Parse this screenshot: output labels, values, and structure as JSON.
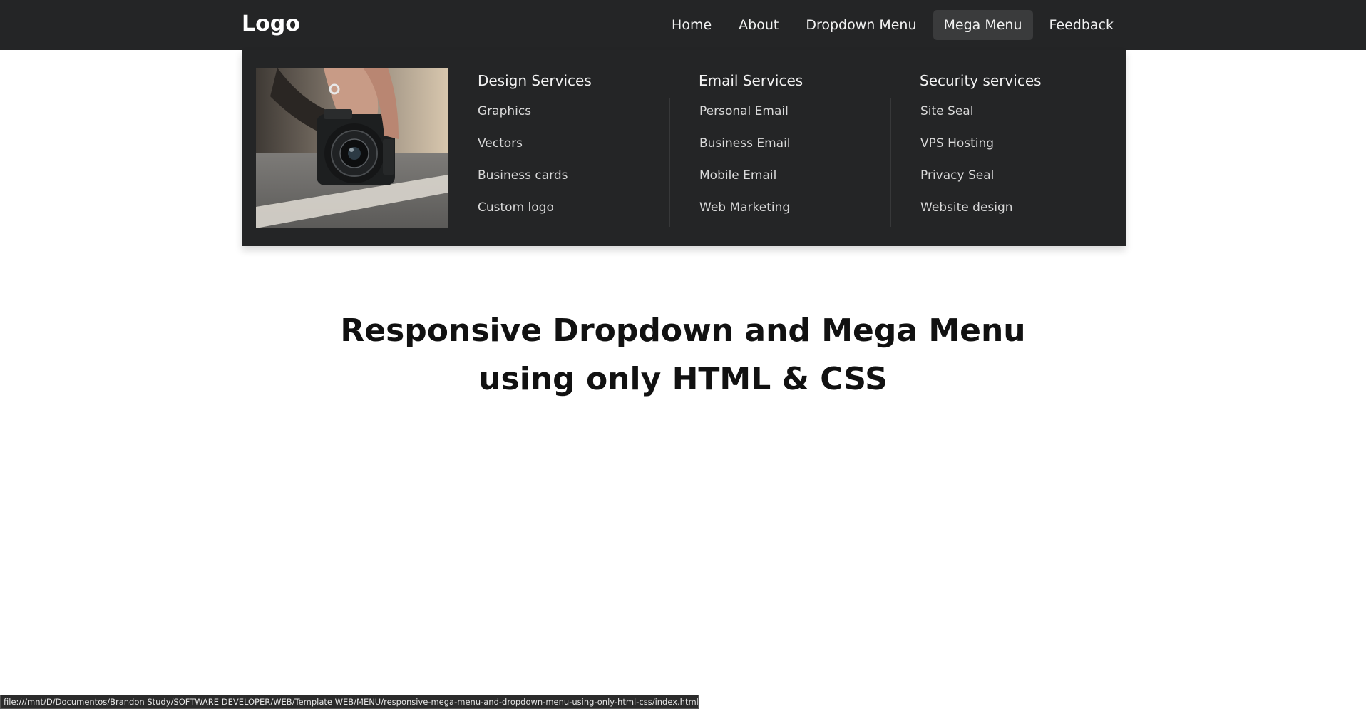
{
  "navbar": {
    "logo": "Logo",
    "links": [
      {
        "label": "Home"
      },
      {
        "label": "About"
      },
      {
        "label": "Dropdown Menu"
      },
      {
        "label": "Mega Menu"
      },
      {
        "label": "Feedback"
      }
    ],
    "active_link": "Mega Menu"
  },
  "mega_menu": {
    "image": "camera-photo",
    "columns": [
      {
        "heading": "Design Services",
        "items": [
          "Graphics",
          "Vectors",
          "Business cards",
          "Custom logo"
        ]
      },
      {
        "heading": "Email Services",
        "items": [
          "Personal Email",
          "Business Email",
          "Mobile Email",
          "Web Marketing"
        ]
      },
      {
        "heading": "Security services",
        "items": [
          "Site Seal",
          "VPS Hosting",
          "Privacy Seal",
          "Website design"
        ]
      }
    ]
  },
  "hero": {
    "line1": "Responsive Dropdown and Mega Menu",
    "line2": "using only HTML & CSS"
  },
  "status_bar": {
    "url": "file:///mnt/D/Documentos/Brandon Study/SOFTWARE DEVELOPER/WEB/Template WEB/MENU/responsive-mega-menu-and-dropdown-menu-using-only-html-css/index.html#"
  },
  "colors": {
    "navbar_bg": "#242526",
    "active_link_bg": "#3a3b3c",
    "text_light": "#f2f2f2",
    "hero_text": "#111111"
  }
}
